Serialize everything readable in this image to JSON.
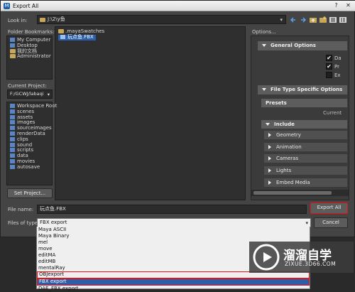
{
  "window": {
    "title": "Export All"
  },
  "look_in": {
    "label": "Look in:",
    "value": "J:\\2\\y鱼"
  },
  "bookmarks": {
    "label": "Folder Bookmarks:",
    "items": [
      "My Computer",
      "Desktop",
      "我的文档",
      "Administrator"
    ]
  },
  "files": {
    "items": [
      ".mayaSwatches",
      "玩点鱼.FBX"
    ]
  },
  "project": {
    "label": "Current Project:",
    "value": "F:/GCWJ/labaqi",
    "folders": [
      "Workspace Root",
      "scenes",
      "assets",
      "images",
      "sourceimages",
      "renderData",
      "clips",
      "sound",
      "scripts",
      "data",
      "movies",
      "autosave"
    ],
    "set_label": "Set Project..."
  },
  "options": {
    "label": "Options...",
    "general_label": "General Options",
    "checkbox_labels": [
      "Da",
      "Pr",
      "Ex"
    ],
    "filetype_label": "File Type Specific Options",
    "presets_label": "Presets",
    "current_label": "Current",
    "include_label": "Include",
    "subs": [
      "Geometry",
      "Animation",
      "Cameras",
      "Lights",
      "Embed Media"
    ]
  },
  "file_name": {
    "label": "File name:",
    "value": "玩点鱼.FBX"
  },
  "file_type": {
    "label": "Files of type:",
    "value": "FBX export",
    "options": [
      "Maya ASCII",
      "Maya Binary",
      "mel",
      "move",
      "editMA",
      "editMB",
      "mentalRay",
      "OBJexport",
      "FBX export",
      "DAE_FBX export"
    ],
    "selected": "FBX export"
  },
  "buttons": {
    "export": "Export All",
    "cancel": "Cancel"
  },
  "watermark": {
    "main": "溜溜自学",
    "sub": "ZIXUE.3D66.COM"
  }
}
